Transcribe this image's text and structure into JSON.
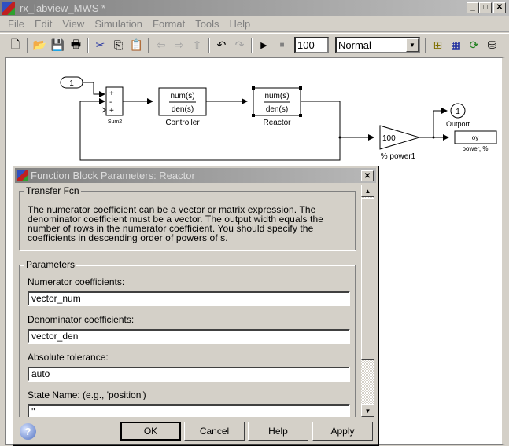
{
  "window": {
    "title": "rx_labview_MWS *"
  },
  "menu": [
    "File",
    "Edit",
    "View",
    "Simulation",
    "Format",
    "Tools",
    "Help"
  ],
  "toolbar": {
    "stop_time": "100",
    "sim_mode": "Normal",
    "icons": [
      "new-icon",
      "open-icon",
      "save-icon",
      "print-icon",
      "cut-icon",
      "copy-icon",
      "paste-icon",
      "back-icon",
      "forward-icon",
      "up-icon",
      "undo-icon",
      "redo-icon",
      "run-icon",
      "stop-icon",
      "library-browser-icon",
      "model-explorer-icon",
      "update-diagram-icon",
      "build-icon"
    ]
  },
  "diagram": {
    "inport_label": "1",
    "sum_label": "Sum2",
    "sum_signs": [
      "+",
      "-",
      "+"
    ],
    "controller": {
      "num": "num(s)",
      "den": "den(s)",
      "name": "Controller"
    },
    "reactor": {
      "num": "num(s)",
      "den": "den(s)",
      "name": "Reactor"
    },
    "gain": {
      "value": "100",
      "name": "% power1"
    },
    "outport": {
      "value": "1",
      "name": "Outport"
    },
    "workspace": {
      "value": "oy",
      "name": "power, %"
    }
  },
  "dialog": {
    "title": "Function Block Parameters: Reactor",
    "section1": "Transfer Fcn",
    "description": "The numerator coefficient can be a vector or matrix expression. The denominator coefficient must be a vector. The output width equals the number of rows in the numerator coefficient. You should specify the coefficients in descending order of powers of s.",
    "section2": "Parameters",
    "params": [
      {
        "label": "Numerator coefficients:",
        "value": "vector_num"
      },
      {
        "label": "Denominator coefficients:",
        "value": "vector_den"
      },
      {
        "label": "Absolute tolerance:",
        "value": "auto"
      },
      {
        "label": "State Name: (e.g., 'position')",
        "value": "''"
      }
    ],
    "buttons": {
      "ok": "OK",
      "cancel": "Cancel",
      "help": "Help",
      "apply": "Apply"
    }
  }
}
